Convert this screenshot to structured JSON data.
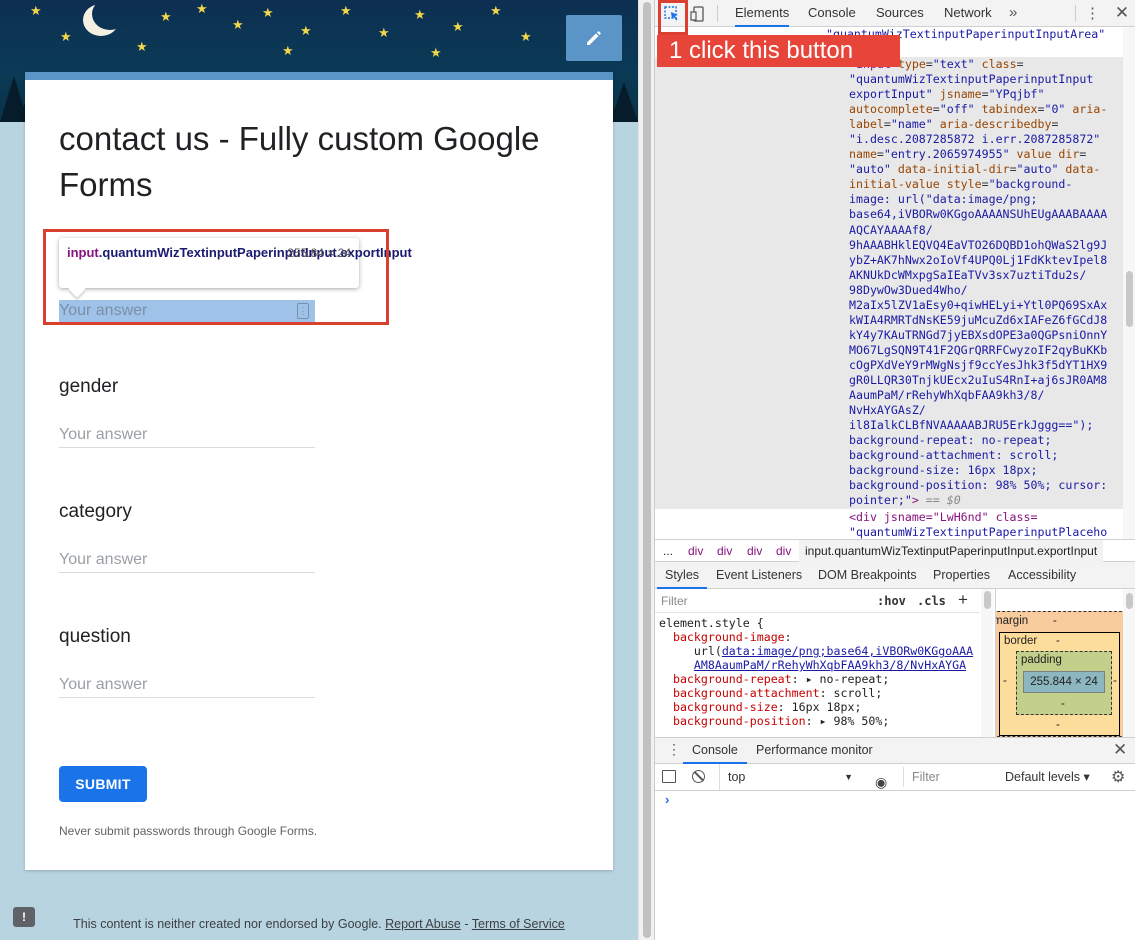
{
  "form": {
    "title": "contact us - Fully custom Google Forms",
    "questions": [
      {
        "label": "",
        "placeholder": "Your answer"
      },
      {
        "label": "gender",
        "placeholder": "Your answer"
      },
      {
        "label": "category",
        "placeholder": "Your answer"
      },
      {
        "label": "question",
        "placeholder": "Your answer"
      }
    ],
    "submit_label": "SUBMIT",
    "password_warning": "Never submit passwords through Google Forms.",
    "footer_text": "This content is neither created nor endorsed by Google.",
    "report_abuse": "Report Abuse",
    "footer_separator": " - ",
    "terms": "Terms of Service",
    "feedback_icon_glyph": "!"
  },
  "inspector_tooltip": {
    "tag": "input",
    "selector_rest": ".quantumWizTextinputPaperinputInput.exportInput",
    "size": "255.84 × 24"
  },
  "callout": {
    "text": "1 click this button"
  },
  "devtools": {
    "tabs": [
      "Elements",
      "Console",
      "Sources",
      "Network",
      "»"
    ],
    "code_top": "\"quantumWizTextinputPaperinputInputArea\"",
    "code_after_1": "<div jsname=\"LwH6nd\" class=",
    "code_after_2": "\"quantumWizTextinputPaperinputPlaceho",
    "selected_suffix": " == $0",
    "breadcrumb": [
      "...",
      "div",
      "div",
      "div",
      "div"
    ],
    "breadcrumb_selected": "input.quantumWizTextinputPaperinputInput.exportInput",
    "subtabs": [
      "Styles",
      "Event Listeners",
      "DOM Breakpoints",
      "Properties",
      "Accessibility"
    ],
    "styles_filter_placeholder": "Filter",
    "hov": ":hov",
    "cls": ".cls",
    "new_rule": "+",
    "box_model": {
      "margin": "margin",
      "border": "border",
      "padding": "padding",
      "content": "255.844 × 24",
      "dash": "-"
    },
    "drawer_tabs": [
      "Console",
      "Performance monitor"
    ],
    "console_context": "top",
    "console_filter_placeholder": "Filter",
    "console_levels": "Default levels ▾",
    "console_prompt": "›"
  },
  "icons": {
    "inspect": "inspect-element-icon",
    "device": "device-toolbar-icon",
    "edit": "pencil-icon",
    "gear": "gear-icon",
    "eye": "eye-icon"
  },
  "colors": {
    "accent": "#1a73e8",
    "highlight_red": "#d9402f",
    "form_theme": "#5b95c7",
    "page_bg": "#b8d4e0"
  }
}
